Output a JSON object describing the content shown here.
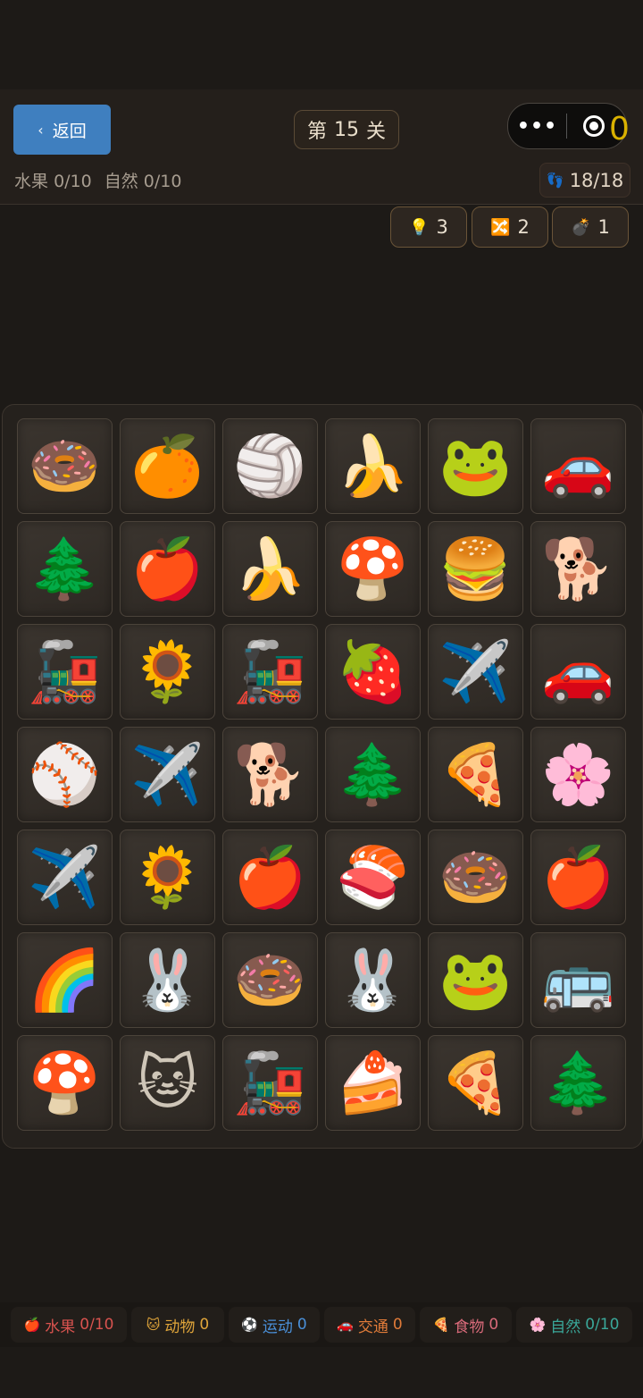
{
  "header": {
    "back_label": "返回",
    "level_prefix": "第",
    "level_number": "15",
    "level_suffix": "关",
    "menu_dots": "•••",
    "score": "0",
    "progress": [
      {
        "label": "水果",
        "value": "0/10"
      },
      {
        "label": "自然",
        "value": "0/10"
      }
    ],
    "moves": "18/18"
  },
  "tools": [
    {
      "icon": "💡",
      "count": "3"
    },
    {
      "icon": "🔀",
      "count": "2"
    },
    {
      "icon": "💣",
      "count": "1"
    }
  ],
  "board": {
    "tiles": [
      "🍩",
      "🍊",
      "🏐",
      "🍌",
      "🐸",
      "🚗",
      "🌲",
      "🍎",
      "🍌",
      "🍄",
      "🍔",
      "🐕",
      "🚂",
      "🌻",
      "🚂",
      "🍓",
      "✈️",
      "🚗",
      "⚾",
      "✈️",
      "🐕",
      "🌲",
      "🍕",
      "🌸",
      "✈️",
      "🌻",
      "🍎",
      "🍣",
      "🍩",
      "🍎",
      "🌈",
      "🐰",
      "🍩",
      "🐰",
      "🐸",
      "🚌",
      "🍄",
      "🐱",
      "🚂",
      "🍰",
      "🍕",
      "🌲"
    ]
  },
  "categories": [
    {
      "icon": "🍎",
      "label": "水果",
      "value": "0/10",
      "color": "#d9534f"
    },
    {
      "icon": "🐱",
      "label": "动物",
      "value": "0",
      "color": "#e0a53a"
    },
    {
      "icon": "⚽",
      "label": "运动",
      "value": "0",
      "color": "#4a90d9"
    },
    {
      "icon": "🚗",
      "label": "交通",
      "value": "0",
      "color": "#e07b39"
    },
    {
      "icon": "🍕",
      "label": "食物",
      "value": "0",
      "color": "#d96a7a"
    },
    {
      "icon": "🌸",
      "label": "自然",
      "value": "0/10",
      "color": "#3aa89a"
    }
  ]
}
